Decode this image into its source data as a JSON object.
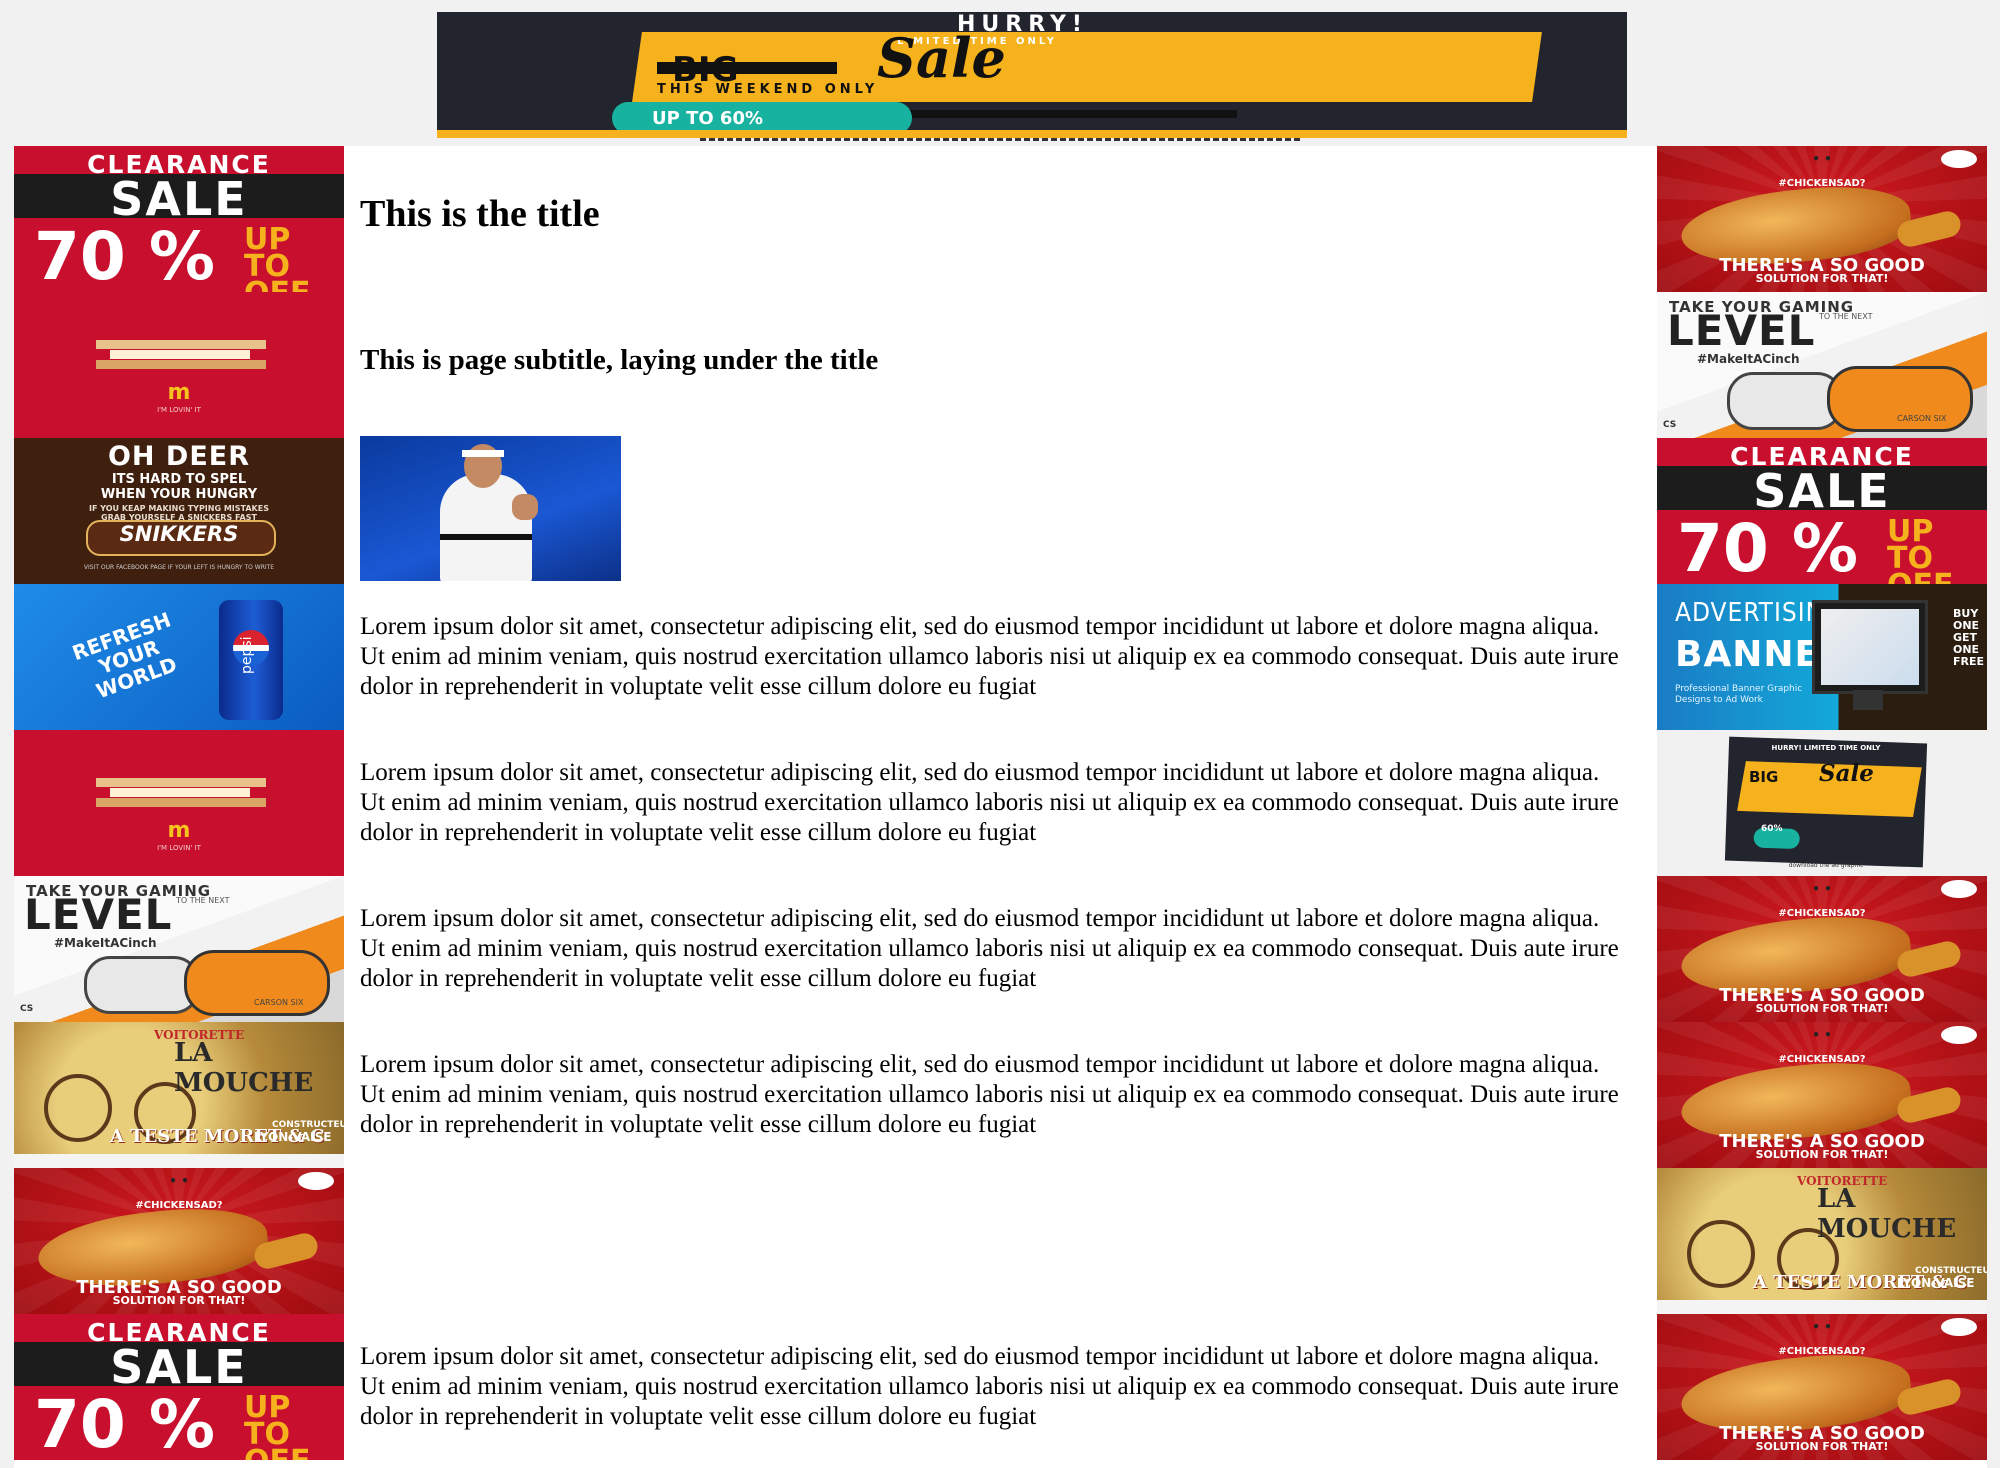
{
  "top_banner": {
    "kicker": "HURRY!",
    "line1": "LIMITED TIME ONLY",
    "word_big": "BIG",
    "word_sale": "Sale",
    "line2": "THIS WEEKEND ONLY",
    "pill": "UP TO 60%"
  },
  "content": {
    "title": "This is the title",
    "subtitle": "This is page subtitle, laying under the title",
    "photo_alt": "Tennis player clenching fist",
    "paragraphs": [
      "Lorem ipsum dolor sit amet, consectetur adipiscing elit, sed do eiusmod tempor incididunt ut labore et dolore magna aliqua. Ut enim ad minim veniam, quis nostrud exercitation ullamco laboris nisi ut aliquip ex ea commodo consequat. Duis aute irure dolor in reprehenderit in voluptate velit esse cillum dolore eu fugiat",
      "Lorem ipsum dolor sit amet, consectetur adipiscing elit, sed do eiusmod tempor incididunt ut labore et dolore magna aliqua. Ut enim ad minim veniam, quis nostrud exercitation ullamco laboris nisi ut aliquip ex ea commodo consequat. Duis aute irure dolor in reprehenderit in voluptate velit esse cillum dolore eu fugiat",
      "Lorem ipsum dolor sit amet, consectetur adipiscing elit, sed do eiusmod tempor incididunt ut labore et dolore magna aliqua. Ut enim ad minim veniam, quis nostrud exercitation ullamco laboris nisi ut aliquip ex ea commodo consequat. Duis aute irure dolor in reprehenderit in voluptate velit esse cillum dolore eu fugiat",
      "Lorem ipsum dolor sit amet, consectetur adipiscing elit, sed do eiusmod tempor incididunt ut labore et dolore magna aliqua. Ut enim ad minim veniam, quis nostrud exercitation ullamco laboris nisi ut aliquip ex ea commodo consequat. Duis aute irure dolor in reprehenderit in voluptate velit esse cillum dolore eu fugiat",
      "Lorem ipsum dolor sit amet, consectetur adipiscing elit, sed do eiusmod tempor incididunt ut labore et dolore magna aliqua. Ut enim ad minim veniam, quis nostrud exercitation ullamco laboris nisi ut aliquip ex ea commodo consequat. Duis aute irure dolor in reprehenderit in voluptate velit esse cillum dolore eu fugiat"
    ]
  },
  "ads": {
    "clearance": {
      "t1": "CLEARANCE",
      "t2": "SALE",
      "t3": "70 %",
      "t4a": "UP TO",
      "t4b": "OFF"
    },
    "mcd": {
      "logo": "m",
      "small": "I'M LOVIN' IT"
    },
    "deer": {
      "t1": "OH DEER",
      "t2a": "ITS HARD TO SPEL",
      "t2b": "WHEN YOUR HUNGRY",
      "t3a": "IF YOU KEAP MAKING TYPING MISTAKES",
      "t3b": "GRAB YOURSELF A SNICKERS FAST",
      "t4": "SNIKKERS",
      "t5": "VISIT OUR FACEBOOK PAGE IF YOUR LEFT IS HUNGRY TO WRITE"
    },
    "pepsi": {
      "slogan1": "REFRESH",
      "slogan2": "YOUR",
      "slogan3": "WORLD",
      "can": "pepsi"
    },
    "gaming": {
      "t1": "TAKE YOUR GAMING",
      "t2": "LEVEL",
      "t3": "TO THE NEXT",
      "t4": "#MakeItACinch",
      "t5": "CARSON SIX",
      "t6": "CS"
    },
    "mouche": {
      "t1": "VOITORETTE",
      "t2": "LA MOUCHE",
      "t3": "A TESTE MORET & C",
      "t4a": "CONSTRUCTEURS",
      "t4b": "LYON-VAISE"
    },
    "chicken": {
      "face": "• •",
      "t1": "#CHICKENSAD?",
      "t2": "THERE'S A SO GOOD",
      "t3": "SOLUTION FOR THAT!"
    },
    "adv": {
      "t1": "ADVERTISING",
      "t2": "BANNERS",
      "t3a": "Professional Banner Graphic",
      "t3b": "Designs to Ad Work",
      "t4": "BUY ONE GET ONE FREE"
    },
    "sale2": {
      "t1": "HURRY! LIMITED TIME ONLY",
      "t2": "BIG",
      "t3": "Sale",
      "t4": "60%",
      "t5": "download the ad graphic"
    }
  },
  "colors": {
    "red": "#c8102e",
    "yellow": "#f6b21c",
    "dark": "#23252e",
    "teal": "#17b3a0"
  }
}
